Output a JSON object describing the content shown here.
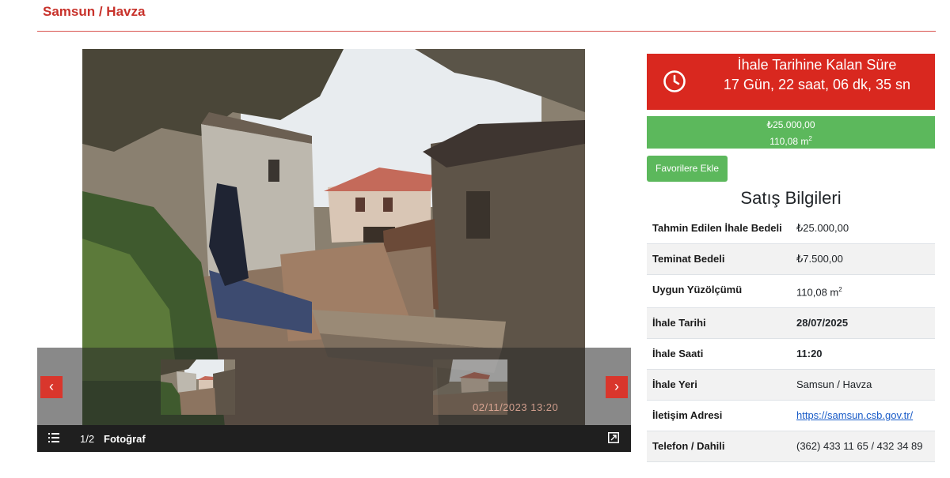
{
  "breadcrumb": "Samsun / Havza",
  "gallery": {
    "counter": "1/2",
    "caption": "Fotoğraf",
    "photo_date": "02/11/2023 13:20",
    "prev_label": "‹",
    "next_label": "›"
  },
  "countdown": {
    "title": "İhale Tarihine Kalan Süre",
    "value": "17 Gün, 22 saat, 06 dk, 35 sn"
  },
  "price": {
    "amount": "₺25.000,00",
    "area": "110,08 m",
    "area_unit_sup": "2"
  },
  "favorite_button": "Favorilere Ekle",
  "sale_info": {
    "title": "Satış Bilgileri",
    "rows": [
      {
        "key": "Tahmin Edilen İhale Bedeli",
        "value": "₺25.000,00"
      },
      {
        "key": "Teminat Bedeli",
        "value": "₺7.500,00"
      },
      {
        "key": "Uygun Yüzölçümü",
        "value": "110,08 m",
        "sup": "2"
      },
      {
        "key": "İhale Tarihi",
        "value": "28/07/2025"
      },
      {
        "key": "İhale Saati",
        "value": "11:20"
      },
      {
        "key": "İhale Yeri",
        "value": "Samsun / Havza"
      },
      {
        "key": "İletişim Adresi",
        "value": "https://samsun.csb.gov.tr/"
      },
      {
        "key": "Telefon / Dahili",
        "value": "(362) 433 11 65 / 432 34 89"
      }
    ]
  },
  "colors": {
    "brand_red": "#d9281f",
    "accent_green": "#5cb85c",
    "link_blue": "#1a5cc8"
  }
}
